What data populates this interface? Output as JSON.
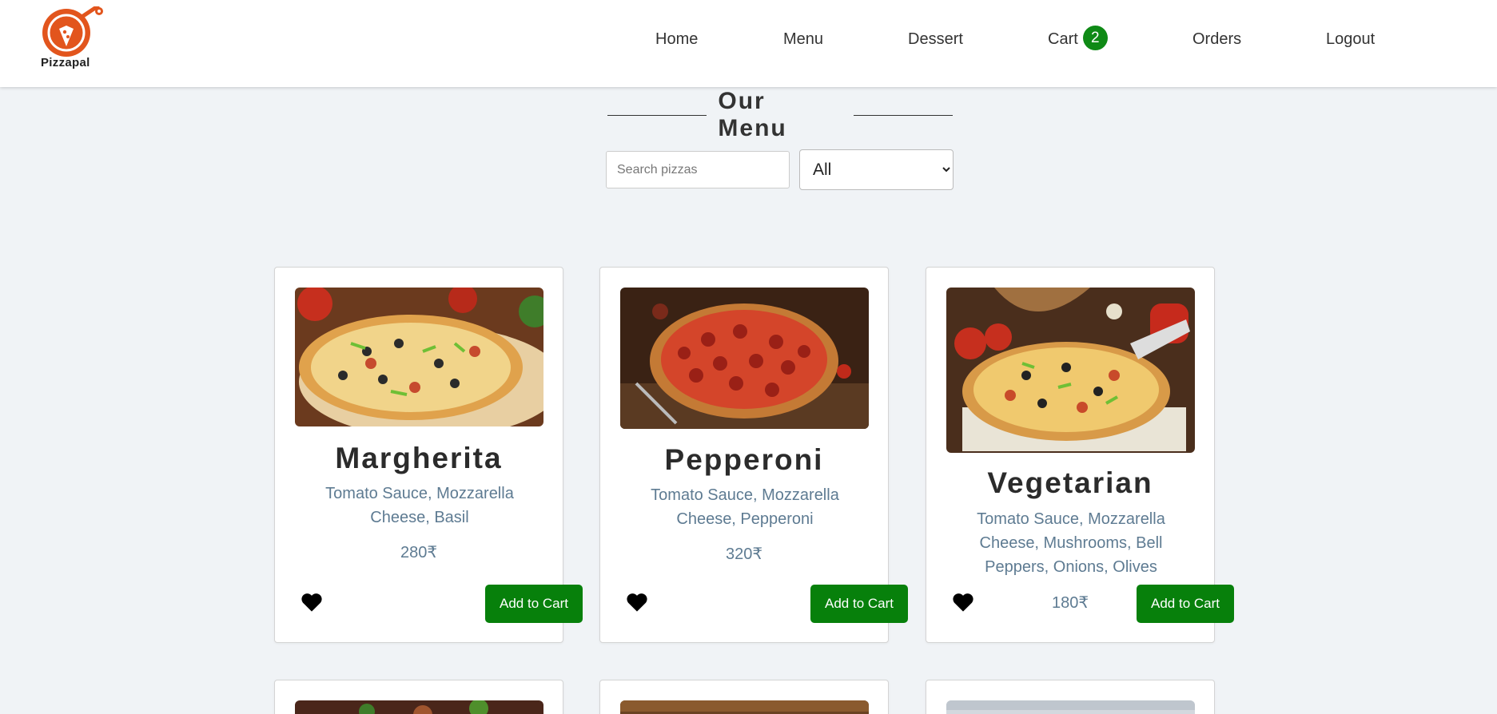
{
  "brand": {
    "name": "Pizzapal"
  },
  "nav": {
    "items": [
      {
        "label": "Home"
      },
      {
        "label": "Menu"
      },
      {
        "label": "Dessert"
      },
      {
        "label": "Cart",
        "badge": "2"
      },
      {
        "label": "Orders"
      },
      {
        "label": "Logout"
      }
    ]
  },
  "menu": {
    "heading": "Our Menu",
    "search_placeholder": "Search pizzas",
    "filter_selected": "All"
  },
  "cards": [
    {
      "name": "Margherita",
      "ingredients": "Tomato Sauce, Mozzarella Cheese, Basil",
      "price": "280₹",
      "button": "Add to Cart"
    },
    {
      "name": "Pepperoni",
      "ingredients": "Tomato Sauce, Mozzarella Cheese, Pepperoni",
      "price": "320₹",
      "button": "Add to Cart"
    },
    {
      "name": "Vegetarian",
      "ingredients": "Tomato Sauce, Mozzarella Cheese, Mushrooms, Bell Peppers, Onions, Olives",
      "price": "180₹",
      "button": "Add to Cart"
    }
  ],
  "colors": {
    "accent": "#07800b",
    "badge": "#0f8a16",
    "logo": "#e2551d",
    "text_muted": "#5e7b92",
    "background": "#f0f3f6"
  }
}
